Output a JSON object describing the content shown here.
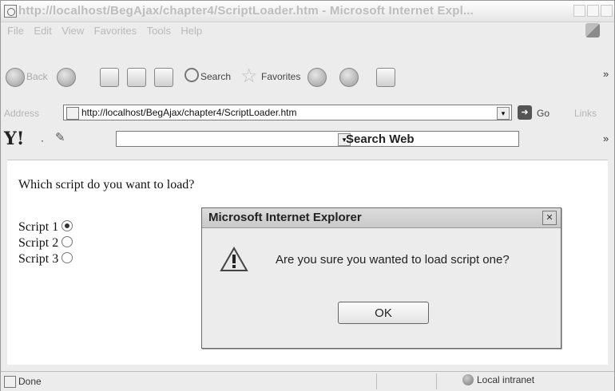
{
  "window": {
    "title": "http://localhost/BegAjax/chapter4/ScriptLoader.htm - Microsoft Internet Expl..."
  },
  "menu": [
    "File",
    "Edit",
    "View",
    "Favorites",
    "Tools",
    "Help"
  ],
  "toolbar": {
    "back_label": "Back",
    "search_label": "Search",
    "favorites_label": "Favorites"
  },
  "address": {
    "label": "Address",
    "value": "http://localhost/BegAjax/chapter4/ScriptLoader.htm",
    "go_label": "Go",
    "links_label": "Links"
  },
  "yahoo": {
    "logo": "Y!",
    "search_label": "Search Web"
  },
  "page": {
    "question": "Which script do you want to load?",
    "options": [
      {
        "label": "Script 1",
        "checked": true
      },
      {
        "label": "Script 2",
        "checked": false
      },
      {
        "label": "Script 3",
        "checked": false
      }
    ]
  },
  "dialog": {
    "title": "Microsoft Internet Explorer",
    "message": "Are you sure you wanted to load script one?",
    "ok_label": "OK"
  },
  "status": {
    "text": "Done",
    "zone": "Local intranet"
  }
}
